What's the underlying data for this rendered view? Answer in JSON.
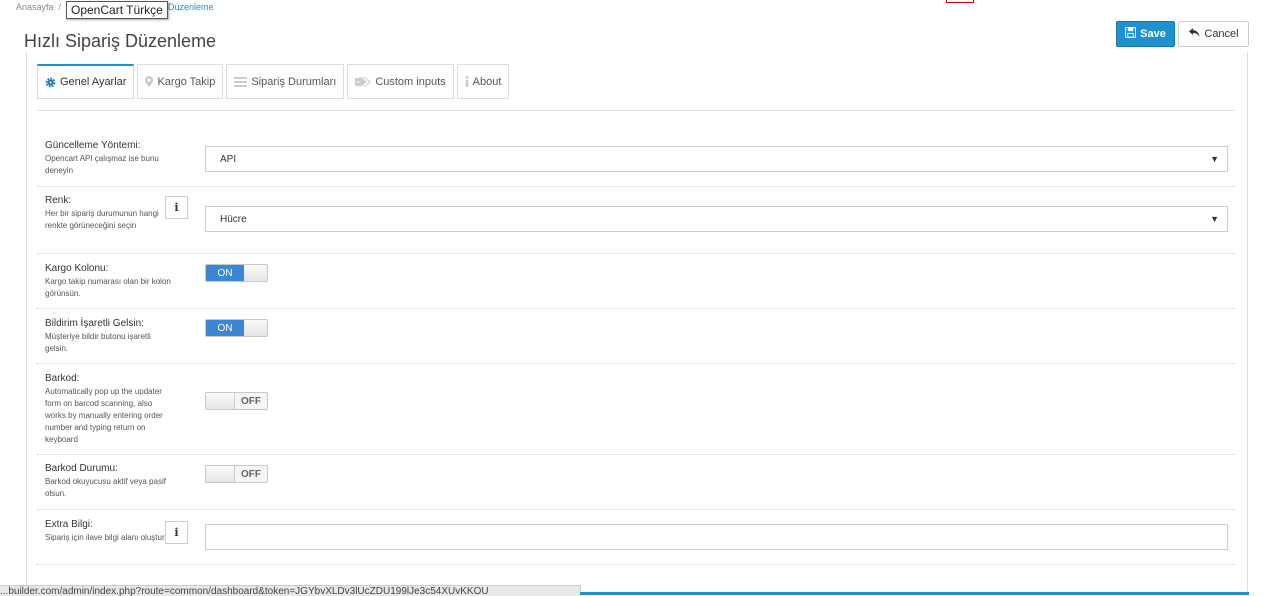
{
  "breadcrumb": {
    "home": "Anasayfa",
    "separator": "/",
    "current": "Düzenleme",
    "tooltip": "OpenCart Türkçe"
  },
  "page": {
    "title": "Hızlı Sipariş Düzenleme"
  },
  "toolbar": {
    "save_label": "Save",
    "cancel_label": "Cancel"
  },
  "tabs": [
    {
      "label": "Genel Ayarlar",
      "icon": "gear-icon",
      "active": true
    },
    {
      "label": "Kargo Takip",
      "icon": "map-marker-icon"
    },
    {
      "label": "Sipariş Durumları",
      "icon": "list-icon"
    },
    {
      "label": "Custom inputs",
      "icon": "tag-icon"
    },
    {
      "label": "About",
      "icon": "info-icon"
    }
  ],
  "fields": {
    "update_method": {
      "label": "Güncelleme Yöntemi:",
      "help": "Opencart API çalışmaz ise bunu deneyin",
      "value": "API"
    },
    "color": {
      "label": "Renk:",
      "help": "Her bir sipariş durumunun hangi renkte görüneceğini seçin",
      "value": "Hücre",
      "info": "i"
    },
    "cargo_column": {
      "label": "Kargo Kolonu:",
      "help": "Kargo takip numarası olan bir kolon görünsün.",
      "state": "ON"
    },
    "notify_checked": {
      "label": "Bildirim İşaretli Gelsin:",
      "help": "Müşteriye bildir butonu işaretli gelsin.",
      "state": "ON"
    },
    "barcode": {
      "label": "Barkod:",
      "help": "Automatically pop up the updater form on barcod scanning, also works by manually entering order number and typing return on keyboard",
      "state": "OFF"
    },
    "barcode_status": {
      "label": "Barkod Durumu:",
      "help": "Barkod okuyucusu aktif veya pasif olsun.",
      "state": "OFF"
    },
    "extra_info": {
      "label": "Extra Bilgi:",
      "help": "Sipariş için ilave bilgi alanı oluştur.",
      "value": "",
      "info": "i"
    }
  },
  "statusbar": {
    "url": "...builder.com/admin/index.php?route=common/dashboard&token=JGYbvXLDv3lUcZDU199lJe3c54XUvKKOU"
  },
  "colors": {
    "accent": "#1e91cf",
    "toggle_on": "#3b87d3"
  }
}
